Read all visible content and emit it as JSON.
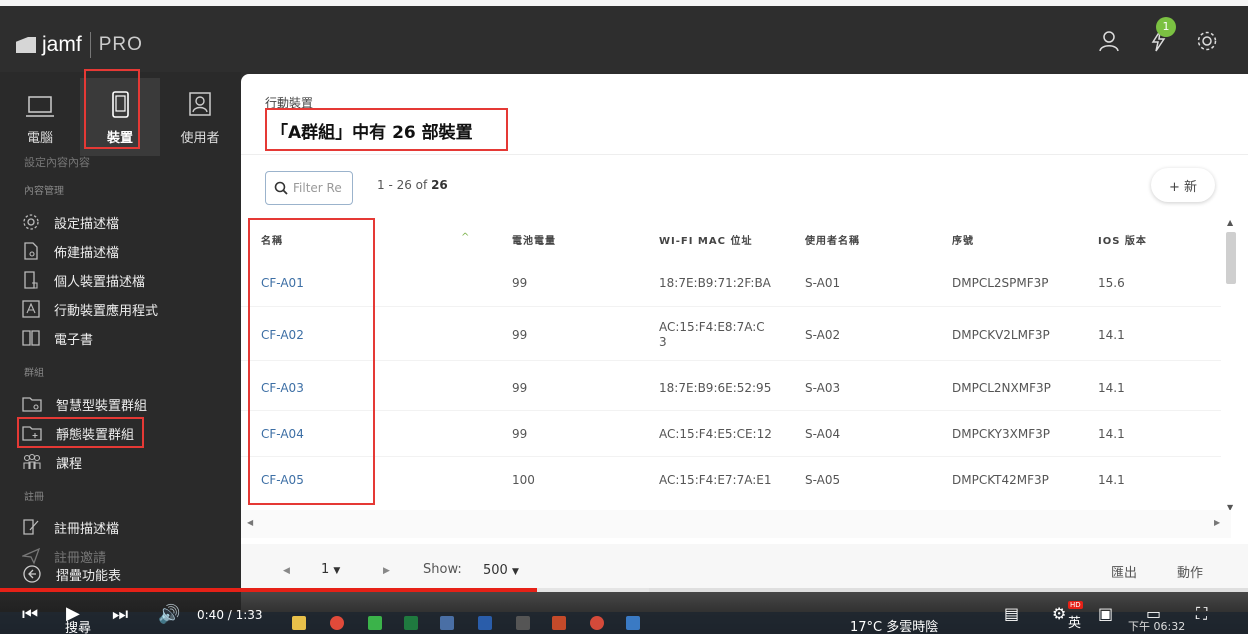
{
  "app": {
    "logo_text": "jamf",
    "logo_pro": "PRO",
    "notification_count": "1"
  },
  "navtabs": [
    {
      "label": "電腦",
      "icon": "laptop-icon"
    },
    {
      "label": "裝置",
      "icon": "mobile-device-icon",
      "active": true
    },
    {
      "label": "使用者",
      "icon": "user-card-icon"
    }
  ],
  "sidebar": {
    "partial_top": "設定內容內容",
    "section_content": "內容管理",
    "content_items": [
      {
        "label": "設定描述檔",
        "icon": "gear-cog-icon"
      },
      {
        "label": "佈建描述檔",
        "icon": "document-gear-icon"
      },
      {
        "label": "個人裝置描述檔",
        "icon": "personal-device-icon"
      },
      {
        "label": "行動裝置應用程式",
        "icon": "app-store-icon"
      },
      {
        "label": "電子書",
        "icon": "book-icon"
      }
    ],
    "section_groups": "群組",
    "group_items": [
      {
        "label": "智慧型裝置群組",
        "icon": "smart-folder-icon"
      },
      {
        "label": "靜態裝置群組",
        "icon": "static-folder-icon"
      },
      {
        "label": "課程",
        "icon": "classes-icon"
      }
    ],
    "section_enroll": "註冊",
    "enroll_items": [
      {
        "label": "註冊描述檔",
        "icon": "enrollment-profile-icon"
      },
      {
        "label": "註冊邀請",
        "icon": "invitation-icon"
      }
    ],
    "collapse_label": "摺疊功能表"
  },
  "main": {
    "breadcrumb": "行動裝置",
    "title": "「A群組」中有 26 部裝置",
    "search_placeholder": "Filter Re",
    "count_prefix": "1 - 26 of ",
    "count_total": "26",
    "new_label": "+ 新"
  },
  "table": {
    "headers": [
      "名稱",
      "電池電量",
      "WI-FI MAC 位址",
      "使用者名稱",
      "序號",
      "IOS 版本"
    ],
    "sort_indicator": "^",
    "rows": [
      {
        "name": "CF-A01",
        "battery": "99",
        "mac1": "18:7E:B9:71:2F:BA",
        "mac2": "",
        "user": "S-A01",
        "serial": "DMPCL2SPMF3P",
        "ios": "15.6"
      },
      {
        "name": "CF-A02",
        "battery": "99",
        "mac1": "AC:15:F4:E8:7A:C",
        "mac2": "3",
        "user": "S-A02",
        "serial": "DMPCKV2LMF3P",
        "ios": "14.1"
      },
      {
        "name": "CF-A03",
        "battery": "99",
        "mac1": "18:7E:B9:6E:52:95",
        "mac2": "",
        "user": "S-A03",
        "serial": "DMPCL2NXMF3P",
        "ios": "14.1"
      },
      {
        "name": "CF-A04",
        "battery": "99",
        "mac1": "AC:15:F4:E5:CE:12",
        "mac2": "",
        "user": "S-A04",
        "serial": "DMPCKY3XMF3P",
        "ios": "14.1"
      },
      {
        "name": "CF-A05",
        "battery": "100",
        "mac1": "AC:15:F4:E7:7A:E1",
        "mac2": "",
        "user": "S-A05",
        "serial": "DMPCKT42MF3P",
        "ios": "14.1"
      }
    ]
  },
  "footer": {
    "page": "1",
    "show_label": "Show:",
    "show_value": "500",
    "export_label": "匯出",
    "actions_label": "動作"
  },
  "player": {
    "time": "0:40 / 1:33",
    "progress_fraction": 0.43,
    "hd_badge": "HD"
  },
  "taskbar": {
    "search_label": "搜尋",
    "weather": "17°C  多雲時陰",
    "lang": "英",
    "clock": "下午 06:32"
  }
}
